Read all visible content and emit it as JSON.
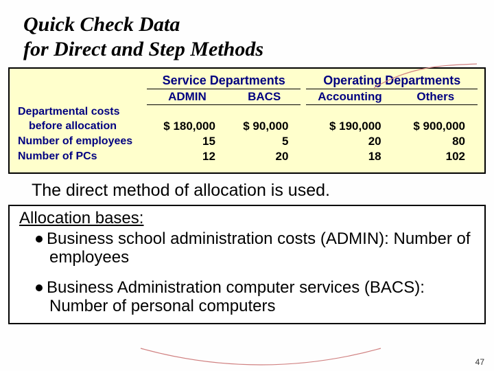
{
  "title_line1": "Quick Check Data",
  "title_line2": "for Direct and Step Methods",
  "table": {
    "group_headers": [
      "Service Departments",
      "Operating Departments"
    ],
    "col_headers": [
      "ADMIN",
      "BACS",
      "Accounting",
      "Others"
    ],
    "rows": [
      {
        "label1": "Departmental costs",
        "label2": "before allocation",
        "values": [
          "$  180,000",
          "$   90,000",
          "$  190,000",
          "$  900,000"
        ]
      },
      {
        "label": "Number of employees",
        "values": [
          "15",
          "5",
          "20",
          "80"
        ]
      },
      {
        "label": "Number of PCs",
        "values": [
          "12",
          "20",
          "18",
          "102"
        ]
      }
    ]
  },
  "statement": "The direct method of allocation is used.",
  "allocation": {
    "heading": "Allocation bases:",
    "bullets": [
      "Business school administration costs (ADMIN):  Number of employees",
      "Business Administration computer services (BACS):  Number of personal computers"
    ]
  },
  "page_number": "47",
  "chart_data": {
    "type": "table",
    "title": "Quick Check Data for Direct and Step Methods",
    "column_groups": [
      {
        "name": "Service Departments",
        "columns": [
          "ADMIN",
          "BACS"
        ]
      },
      {
        "name": "Operating Departments",
        "columns": [
          "Accounting",
          "Others"
        ]
      }
    ],
    "rows": [
      {
        "label": "Departmental costs before allocation",
        "ADMIN": 180000,
        "BACS": 90000,
        "Accounting": 190000,
        "Others": 900000,
        "unit": "USD"
      },
      {
        "label": "Number of employees",
        "ADMIN": 15,
        "BACS": 5,
        "Accounting": 20,
        "Others": 80
      },
      {
        "label": "Number of PCs",
        "ADMIN": 12,
        "BACS": 20,
        "Accounting": 18,
        "Others": 102
      }
    ]
  }
}
